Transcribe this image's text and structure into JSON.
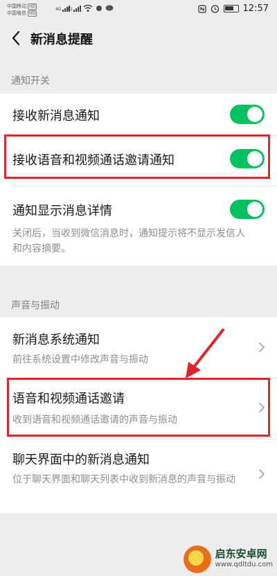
{
  "status_bar": {
    "carrier1": "中国移动",
    "carrier2": "中国电信",
    "hd_badge": "HD",
    "network1": "4G",
    "network2": "4G",
    "time": "12:57",
    "icons": [
      "nfc-icon",
      "alarm-icon",
      "battery-icon",
      "wifi-icon",
      "chat-icon"
    ]
  },
  "header": {
    "title": "新消息提醒",
    "back_icon": "chevron-left-icon"
  },
  "sections": {
    "notify_label": "通知开关",
    "sound_label": "声音与振动"
  },
  "notify": {
    "receive_new": {
      "label": "接收新消息通知",
      "on": true
    },
    "receive_call": {
      "label": "接收语音和视频通话邀请通知",
      "on": true
    },
    "show_detail": {
      "label": "通知显示消息详情",
      "on": true,
      "sub": "关闭后，当收到微信消息时，通知提示将不显示发信人和内容摘要。"
    }
  },
  "sound": {
    "system": {
      "label": "新消息系统通知",
      "sub": "前往系统设置中修改声音与振动"
    },
    "call": {
      "label": "语音和视频通话邀请",
      "sub": "收到语音和视频通话邀请的声音与振动"
    },
    "chat": {
      "label": "聊天界面中的新消息通知",
      "sub": "位于聊天界面和聊天列表中收到新消息的声音与振动"
    }
  },
  "watermark": {
    "name": "启东安卓网",
    "url": "www.qdltdu.com"
  },
  "colors": {
    "accent": "#07c160",
    "highlight": "#e5222a",
    "background": "#ededed"
  }
}
